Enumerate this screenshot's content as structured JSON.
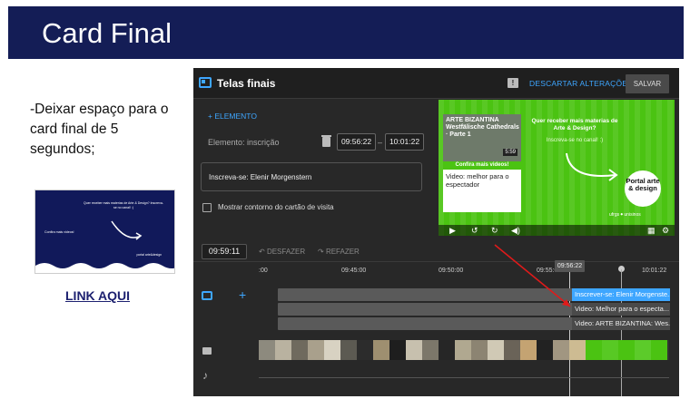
{
  "slide": {
    "title": "Card Final",
    "body_text": "-Deixar espaço para o card final de 5 segundos;",
    "link_text": "LINK AQUI",
    "thumb": {
      "headline": "Quer receber mais materias de Arte & Design? Inscreva-se no canal! :)",
      "left_text": "Confira mais videos!",
      "brand": "portal arte&design"
    }
  },
  "studio": {
    "title": "Telas finais",
    "discard_label": "DESCARTAR ALTERAÇÕES",
    "save_label": "SALVAR",
    "add_element_label": "+ ELEMENTO",
    "element_label": "Elemento: inscrição",
    "start_time": "09:56:22",
    "end_time": "10:01:22",
    "range_dash": "–",
    "subscribe_text": "Inscreva-se: Elenir Morgenstern",
    "business_card_checkbox": "Mostrar contorno do cartão de visita",
    "preview": {
      "video_card_title": "ARTE BIZANTINA Westfälische Cathedrals · Parte 1",
      "video_card_duration": "5:59",
      "video_card_band": "Confira mais videos!",
      "video_card_desc": "Video: melhor para o espectador",
      "headline": "Quer receber mais materias de Arte & Design?",
      "subline": "Inscreva-se no canal! :)",
      "portal_logo": "Portal arte & design",
      "brand_footer": "ufrgs  ⦁  unisinos"
    },
    "current_time": "09:59:11",
    "undo_label": "DESFAZER",
    "redo_label": "REFAZER",
    "ruler_ticks": [
      ":00",
      "09:45:00",
      "09:50:00",
      "09:55:0",
      "10:01:22"
    ],
    "playhead_time": "09:56:22",
    "tracks": [
      {
        "label": "Inscrever-se: Elenir Morgenste...",
        "active": true
      },
      {
        "label": "Video: Melhor para o especta...",
        "active": false
      },
      {
        "label": "Video: ARTE BIZANTINA: Wes...",
        "active": false
      }
    ],
    "accent_color": "#3ea6ff",
    "preview_bg_color": "#4bc312"
  }
}
